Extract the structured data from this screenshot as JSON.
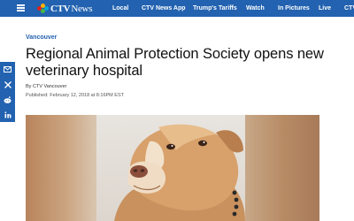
{
  "nav": {
    "logo_ctv": "CTV",
    "logo_news": "News",
    "items": [
      "Local",
      "CTV News App",
      "Trump's Tariffs",
      "Watch",
      "In Pictures",
      "Live",
      "CTV"
    ]
  },
  "share": {
    "icons": [
      "email-icon",
      "x-icon",
      "reddit-icon",
      "linkedin-icon"
    ]
  },
  "article": {
    "section": "Vancouver",
    "headline": "Regional Animal Protection Society opens new veterinary hospital",
    "byline": "By CTV Vancouver",
    "published": "Published: February 12, 2018 at 8:16PM EST"
  },
  "colors": {
    "nav_bg": "#2262b0",
    "accent": "#2262b0",
    "headline": "#111111"
  }
}
